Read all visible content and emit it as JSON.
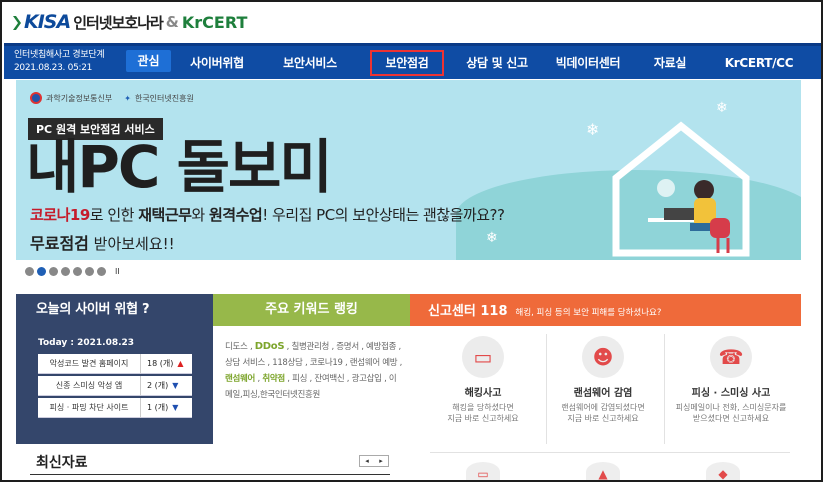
{
  "header": {
    "logo_kisa": "KISA",
    "logo_kor": "인터넷보호나라",
    "logo_amp": "&",
    "logo_krcert": "KrCERT"
  },
  "status": {
    "line1": "인터넷침해사고 경보단계",
    "line2": "2021.08.23. 05:21",
    "level": "관심"
  },
  "nav": {
    "items": [
      {
        "label": "사이버위협"
      },
      {
        "label": "보안서비스"
      },
      {
        "label": "보안점검"
      },
      {
        "label": "상담 및 신고"
      },
      {
        "label": "빅데이터센터"
      },
      {
        "label": "자료실"
      },
      {
        "label": "KrCERT/CC"
      }
    ]
  },
  "banner": {
    "gov1": "과학기술정보통신부",
    "gov2": "한국인터넷진흥원",
    "tag": "PC 원격 보안점검 서비스",
    "title": "내PC 돌보미",
    "l1_a": "코로나19",
    "l1_b": "로 인한 ",
    "l1_c": "재택근무",
    "l1_d": "와 ",
    "l1_e": "원격수업",
    "l1_f": "! 우리집 PC의 보안상태는 괜찮을까요??",
    "l2_a": "무료점검",
    "l2_b": " 받아보세요!!",
    "pause": "II"
  },
  "threat": {
    "title": "오늘의 사이버 위협 ?",
    "today": "Today : 2021.08.23",
    "rows": [
      {
        "label": "악성코드 발견 홈페이지",
        "value": "18 (개)"
      },
      {
        "label": "신종 스미싱 악성 앱",
        "value": "2 (개)"
      },
      {
        "label": "피싱 · 파밍 차단 사이트",
        "value": "1 (개)"
      }
    ]
  },
  "keyword": {
    "title": "주요 키워드 랭킹",
    "t1": "디도스 , ",
    "t2": "DDoS",
    "t3": " , 칠병관리청 , 증명서 , 예방접종 , 상담 서비스 , 118상담 , 코로나19 , 랜섬웨어 예방 , ",
    "t4": "랜섬웨어",
    "t5": " , ",
    "t6": "취약점",
    "t7": " , 피싱 , 잔여백신 , 광고삽입 , 이메일,피싱,한국인터넷진흥원"
  },
  "report": {
    "title": "신고센터 118",
    "sub": "해킹, 피싱 등의 보안 피해를 당하셨나요?",
    "cards": [
      {
        "name": "해킹사고",
        "d1": "해킹을 당하셨다면",
        "d2": "지금 바로 신고하세요"
      },
      {
        "name": "랜섬웨어 감염",
        "d1": "랜섬웨어에 감염되셨다면",
        "d2": "지금 바로 신고하세요"
      },
      {
        "name": "피싱 · 스미싱 사고",
        "d1": "피싱메일이나 전화, 스미싱문자를",
        "d2": "받으셨다면 신고하세요"
      }
    ]
  },
  "recent": {
    "title": "최신자료",
    "prev": "◂",
    "next": "▸"
  }
}
